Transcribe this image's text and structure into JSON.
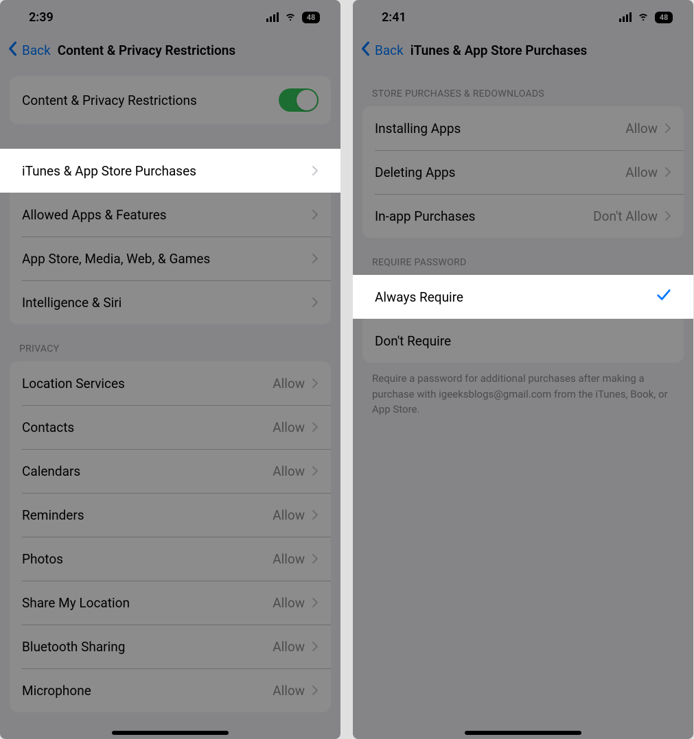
{
  "left": {
    "status": {
      "time": "2:39",
      "battery": "48"
    },
    "nav": {
      "back": "Back",
      "title": "Content & Privacy Restrictions"
    },
    "toggle_row": {
      "label": "Content & Privacy Restrictions"
    },
    "group1": [
      {
        "label": "iTunes & App Store Purchases"
      },
      {
        "label": "Allowed Apps & Features"
      },
      {
        "label": "App Store, Media, Web, & Games"
      },
      {
        "label": "Intelligence & Siri"
      }
    ],
    "privacy_header": "Privacy",
    "privacy_rows": [
      {
        "label": "Location Services",
        "value": "Allow"
      },
      {
        "label": "Contacts",
        "value": "Allow"
      },
      {
        "label": "Calendars",
        "value": "Allow"
      },
      {
        "label": "Reminders",
        "value": "Allow"
      },
      {
        "label": "Photos",
        "value": "Allow"
      },
      {
        "label": "Share My Location",
        "value": "Allow"
      },
      {
        "label": "Bluetooth Sharing",
        "value": "Allow"
      },
      {
        "label": "Microphone",
        "value": "Allow"
      }
    ]
  },
  "right": {
    "status": {
      "time": "2:41",
      "battery": "48"
    },
    "nav": {
      "back": "Back",
      "title": "iTunes & App Store Purchases"
    },
    "store_header": "Store Purchases & Redownloads",
    "store_rows": [
      {
        "label": "Installing Apps",
        "value": "Allow"
      },
      {
        "label": "Deleting Apps",
        "value": "Allow"
      },
      {
        "label": "In-app Purchases",
        "value": "Don't Allow"
      }
    ],
    "require_header": "Require Password",
    "require_rows": [
      {
        "label": "Always Require",
        "checked": true
      },
      {
        "label": "Don't Require",
        "checked": false
      }
    ],
    "footer": "Require a password for additional purchases after making a purchase with igeeksblogs@gmail.com from the iTunes, Book, or App Store."
  }
}
